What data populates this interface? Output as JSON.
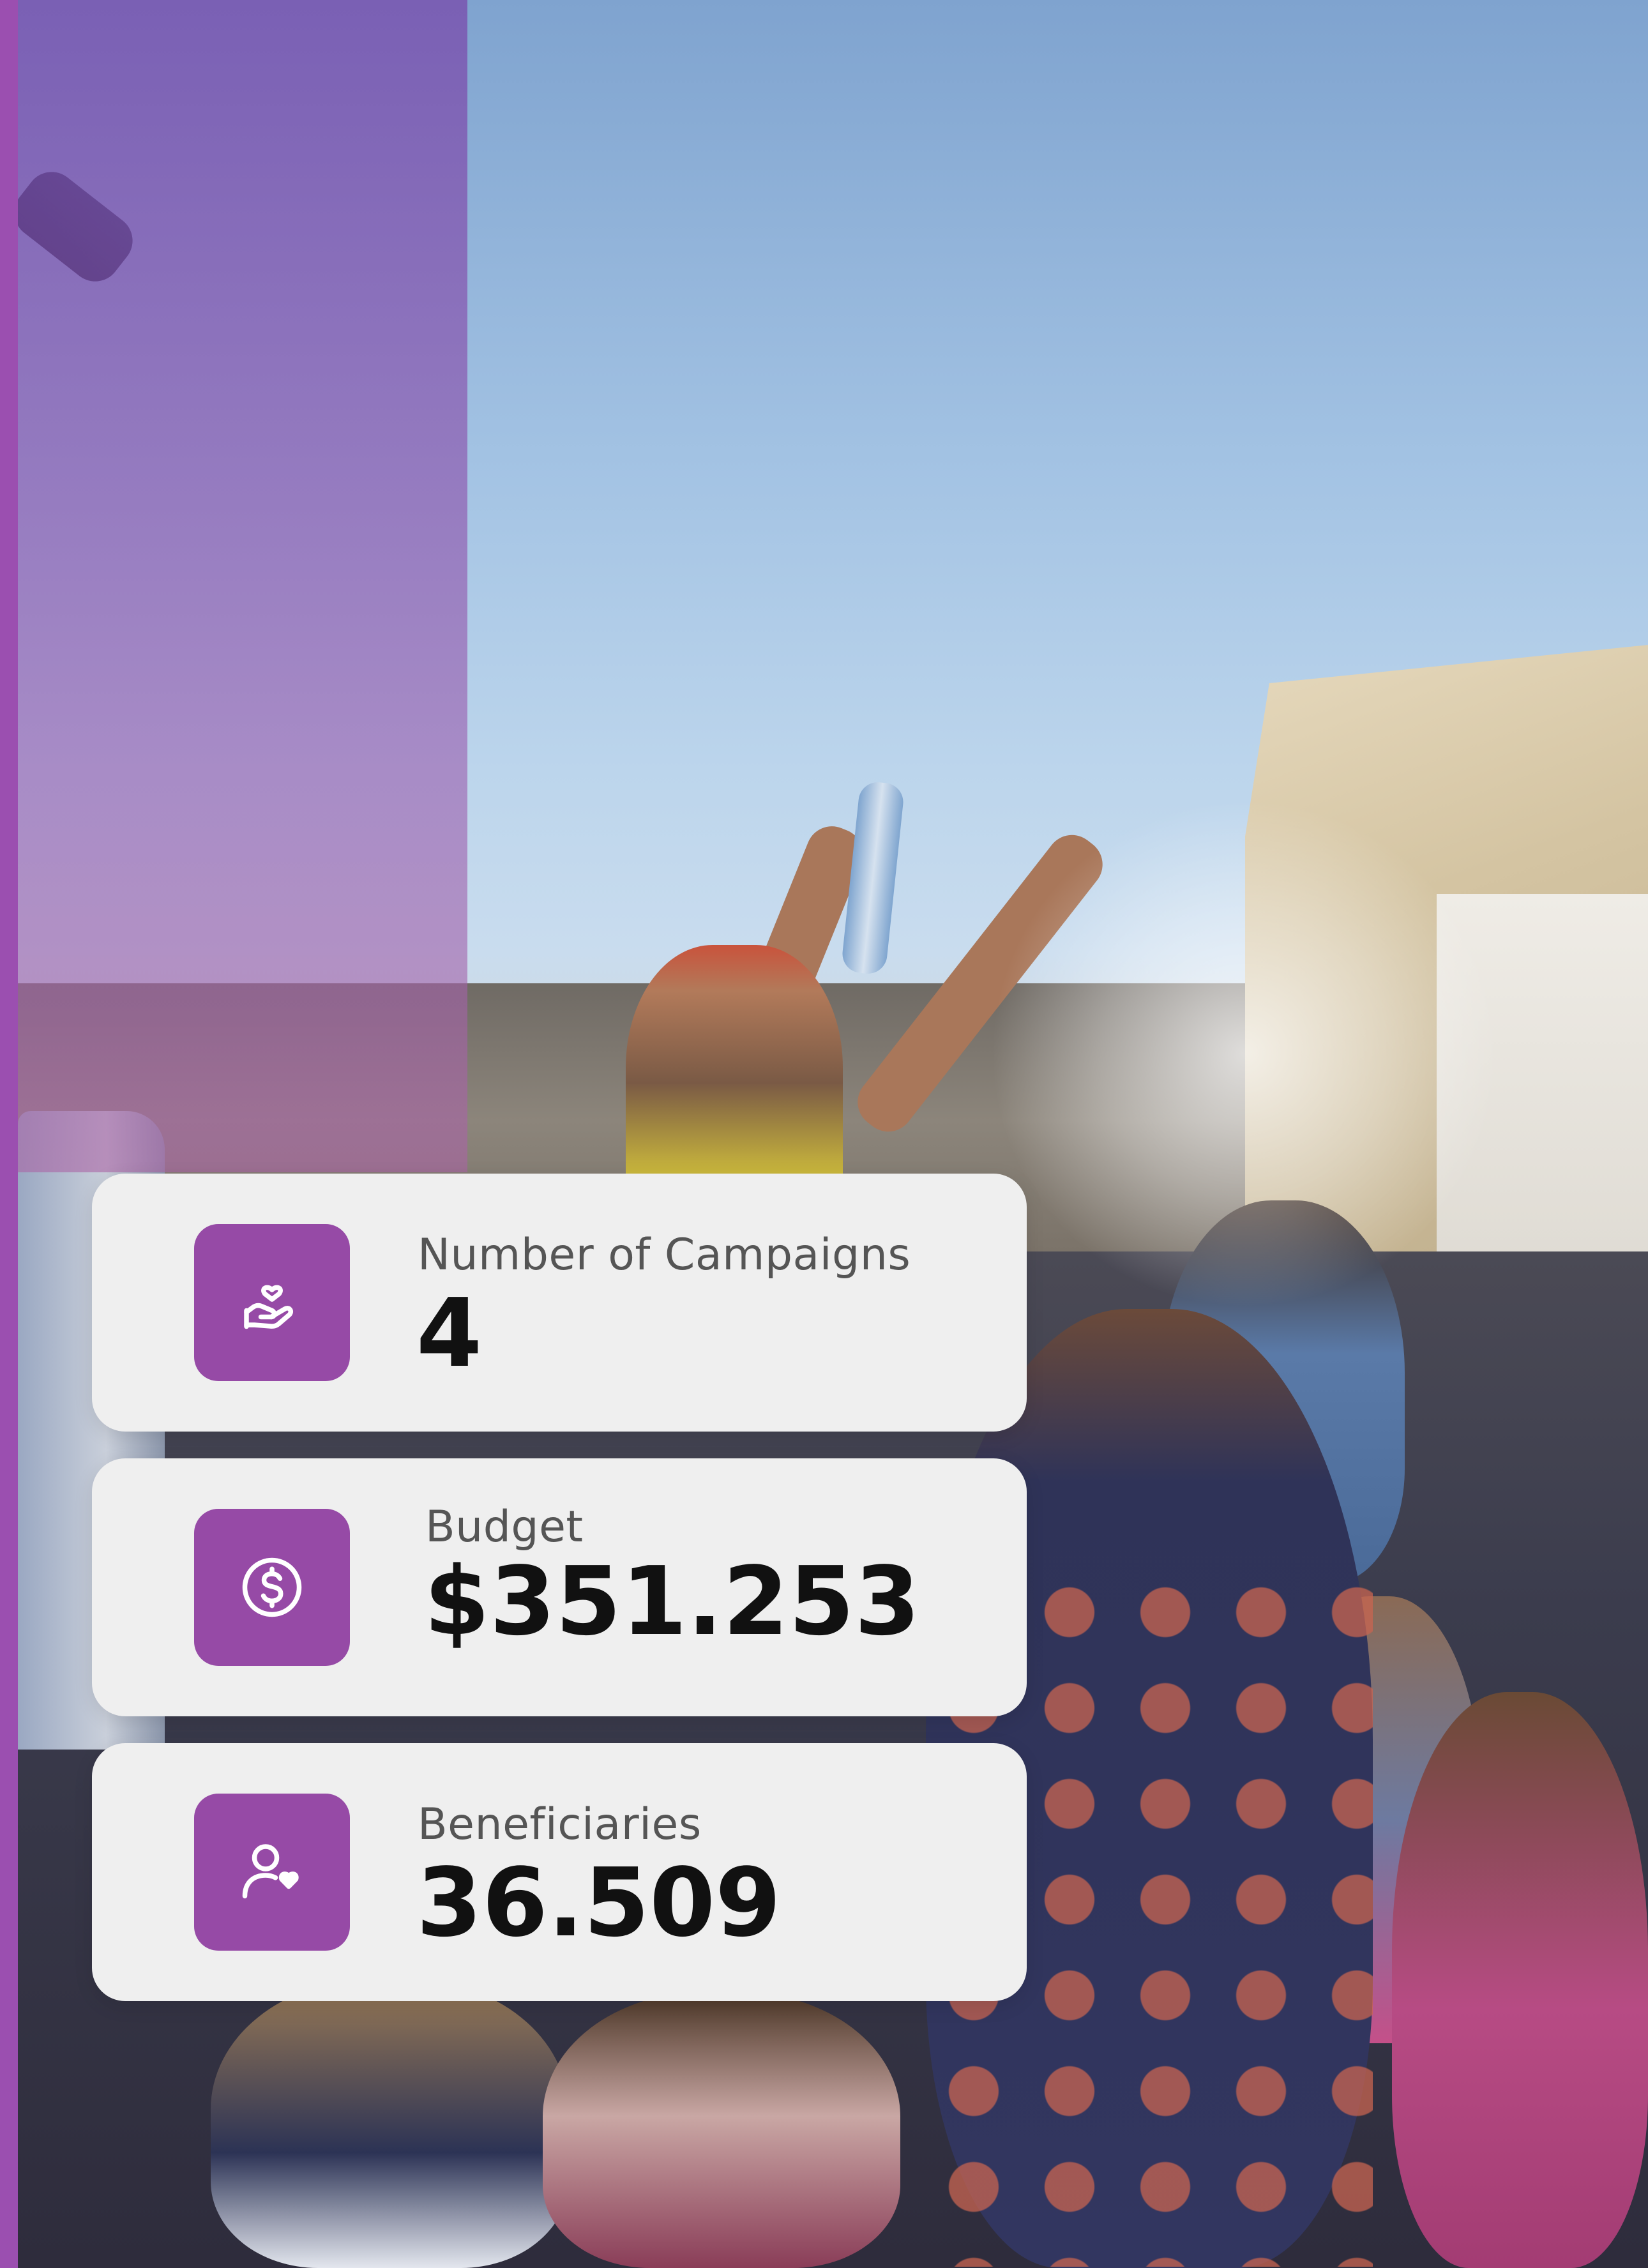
{
  "colors": {
    "accent": "#964aa6",
    "side_strip": "#9b4fb0",
    "card_background": "#efefef",
    "label_text": "#555555",
    "value_text": "#111111"
  },
  "stats": [
    {
      "icon": "heart-hand-icon",
      "label": "Number of Campaigns",
      "value": "4"
    },
    {
      "icon": "dollar-circle-icon",
      "label": "Budget",
      "value": "$351.253"
    },
    {
      "icon": "user-heart-icon",
      "label": "Beneficiaries",
      "value": "36.509"
    }
  ]
}
